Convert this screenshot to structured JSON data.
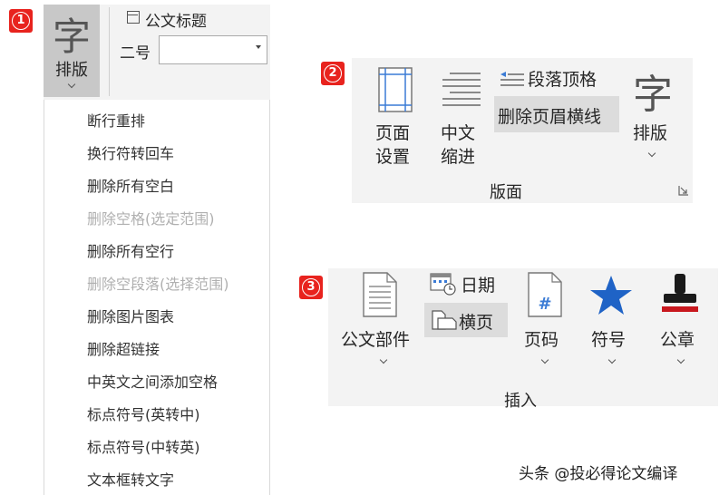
{
  "section1": {
    "badge": "1",
    "format_button": {
      "glyph": "字",
      "label": "排版"
    },
    "title_checkbox_label": "公文标题",
    "size_label": "二号",
    "size_value": "",
    "menu_items": [
      {
        "label": "断行重排",
        "enabled": true
      },
      {
        "label": "换行符转回车",
        "enabled": true
      },
      {
        "label": "删除所有空白",
        "enabled": true
      },
      {
        "label": "删除空格(选定范围)",
        "enabled": false
      },
      {
        "label": "删除所有空行",
        "enabled": true
      },
      {
        "label": "删除空段落(选择范围)",
        "enabled": false
      },
      {
        "label": "删除图片图表",
        "enabled": true
      },
      {
        "label": "删除超链接",
        "enabled": true
      },
      {
        "label": "中英文之间添加空格",
        "enabled": true
      },
      {
        "label": "标点符号(英转中)",
        "enabled": true
      },
      {
        "label": "标点符号(中转英)",
        "enabled": true
      },
      {
        "label": "文本框转文字",
        "enabled": true
      }
    ]
  },
  "section2": {
    "badge": "2",
    "page_setup": [
      "页面",
      "设置"
    ],
    "chinese_indent": [
      "中文",
      "缩进"
    ],
    "para_format": "段落顶格",
    "delete_header_line": "删除页眉横线",
    "format": {
      "glyph": "字",
      "label": "排版"
    },
    "group_label": "版面"
  },
  "section3": {
    "badge": "3",
    "doc_parts": "公文部件",
    "date": "日期",
    "landscape": "横页",
    "page_number": "页码",
    "symbol": "符号",
    "seal": "公章",
    "group_label": "插入"
  },
  "watermark": "头条 @投必得论文编译",
  "colors": {
    "badge": "#e8231e",
    "star": "#1f63c6",
    "seal": "#c8181e"
  }
}
